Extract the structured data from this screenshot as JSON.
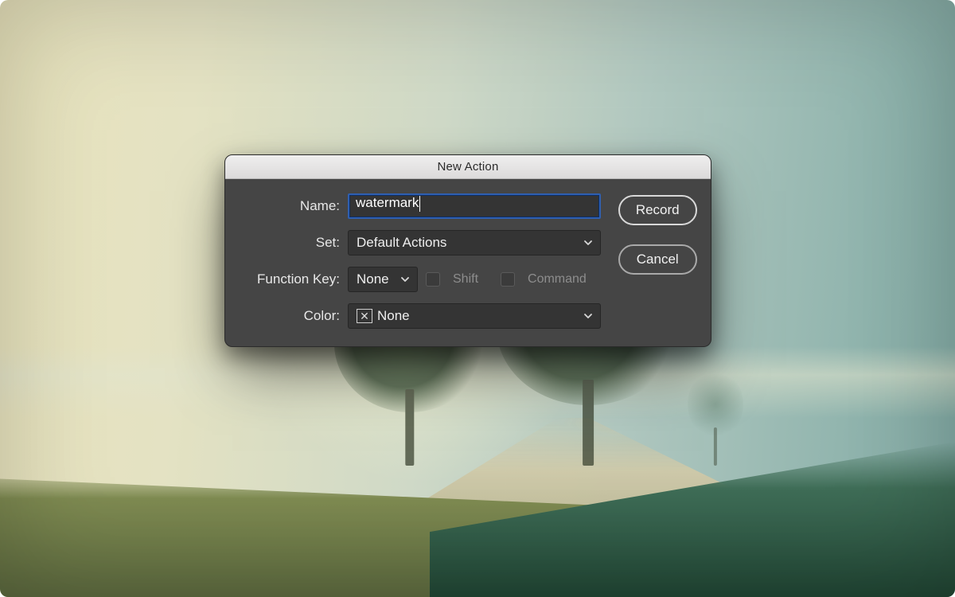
{
  "dialog": {
    "title": "New Action",
    "labels": {
      "name": "Name:",
      "set": "Set:",
      "function_key": "Function Key:",
      "color": "Color:"
    },
    "name_value": "watermark",
    "set_value": "Default Actions",
    "function_key_value": "None",
    "shift_label": "Shift",
    "command_label": "Command",
    "color_value": "None",
    "buttons": {
      "record": "Record",
      "cancel": "Cancel"
    }
  }
}
